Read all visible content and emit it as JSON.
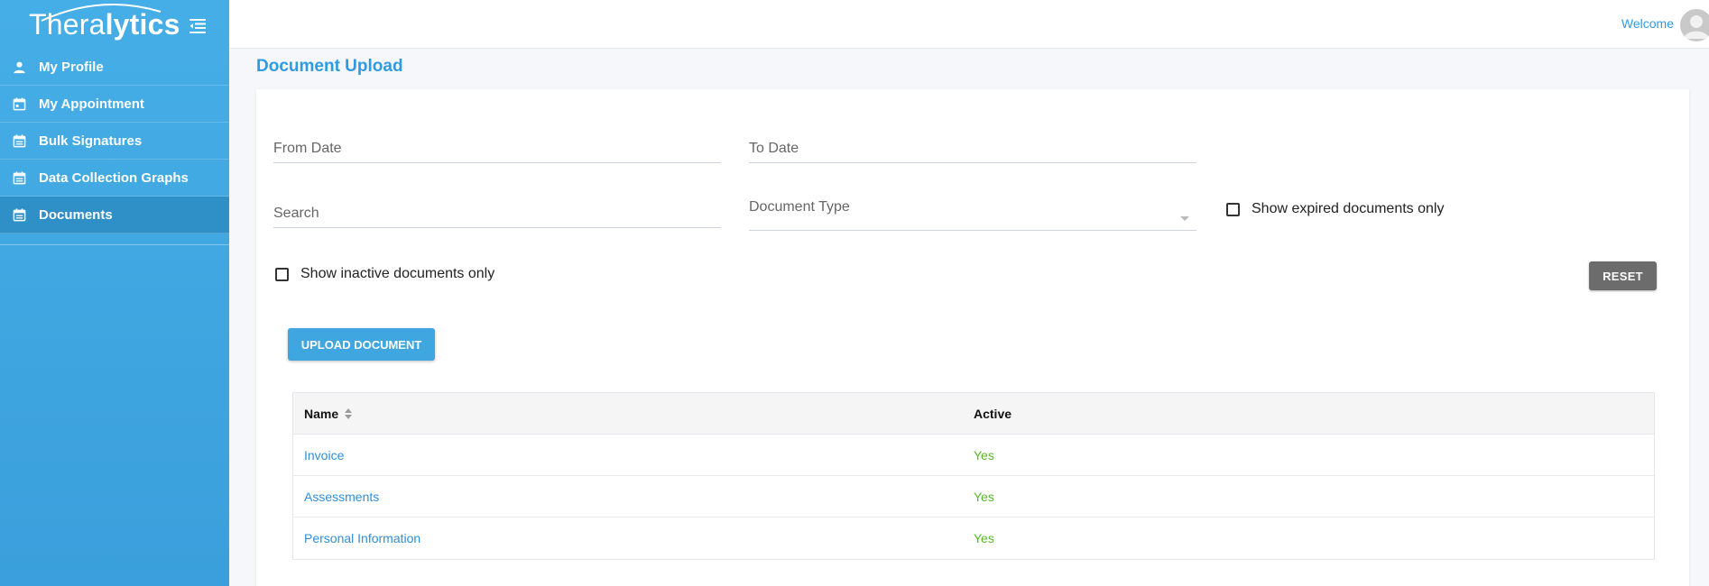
{
  "brand": {
    "logo_thin": "Thera",
    "logo_bold": "lytics"
  },
  "sidebar": {
    "items": [
      {
        "label": "My Profile",
        "icon": "person-icon"
      },
      {
        "label": "My Appointment",
        "icon": "calendar-icon"
      },
      {
        "label": "Bulk Signatures",
        "icon": "calendar-icon"
      },
      {
        "label": "Data Collection Graphs",
        "icon": "calendar-icon"
      },
      {
        "label": "Documents",
        "icon": "calendar-icon",
        "active": true
      }
    ]
  },
  "header": {
    "welcome": "Welcome"
  },
  "page": {
    "title": "Document Upload"
  },
  "filters": {
    "from_date": "From Date",
    "to_date": "To Date",
    "search": "Search",
    "document_type": "Document Type",
    "expired_only": "Show expired documents only",
    "inactive_only": "Show inactive documents only",
    "reset": "RESET"
  },
  "actions": {
    "upload": "UPLOAD DOCUMENT"
  },
  "table": {
    "columns": [
      "Name",
      "Active"
    ],
    "rows": [
      {
        "name": "Invoice",
        "active": "Yes"
      },
      {
        "name": "Assessments",
        "active": "Yes"
      },
      {
        "name": "Personal Information",
        "active": "Yes"
      }
    ]
  },
  "colors": {
    "sidebar": "#46aee6",
    "active_nav": "#2f8fc7",
    "accent": "#2f9be0",
    "yes": "#5bb52d",
    "reset": "#6c6c6c"
  }
}
